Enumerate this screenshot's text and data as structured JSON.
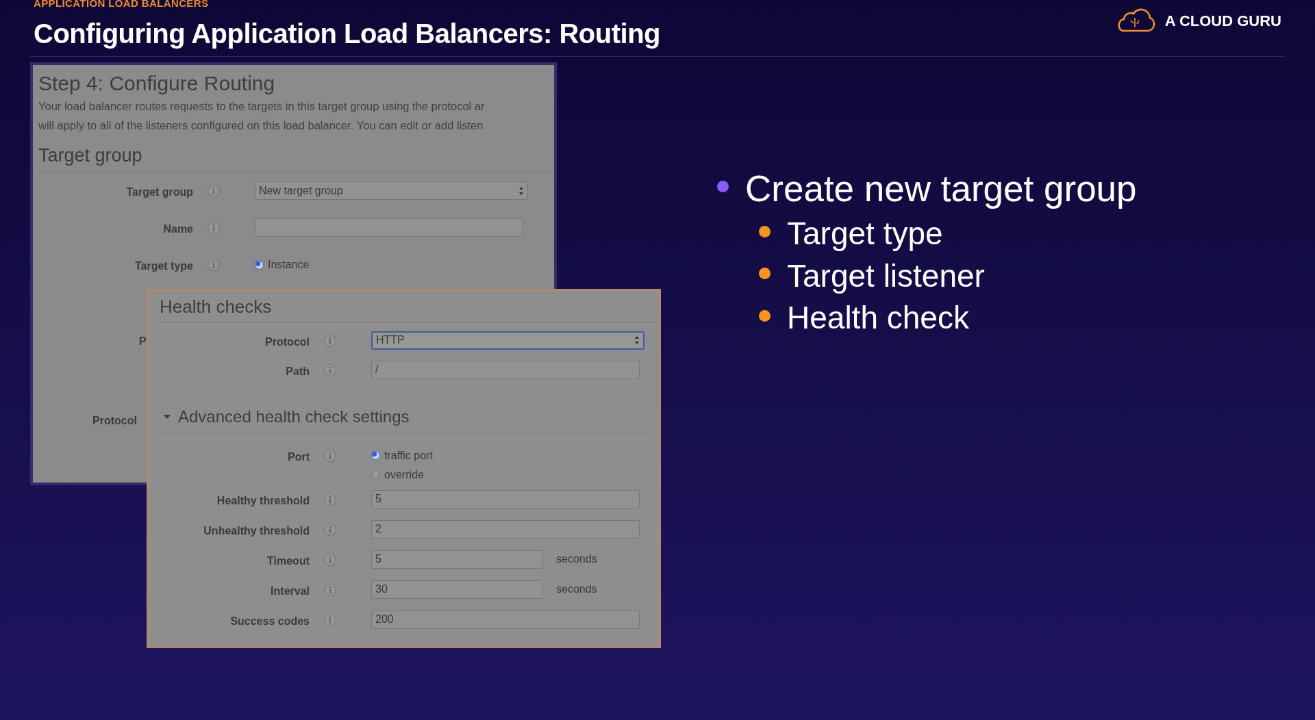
{
  "slide": {
    "section": "APPLICATION LOAD BALANCERS",
    "title": "Configuring Application Load Balancers: Routing"
  },
  "logo": {
    "text": "A CLOUD GURU"
  },
  "routing_step": {
    "title": "Step 4: Configure Routing",
    "description": [
      "Your load balancer routes requests to the targets in this target group using the protocol ar",
      "will apply to all of the listeners configured on this load balancer. You can edit or add listen"
    ],
    "section_title": "Target group",
    "fields": [
      {
        "kind": "select",
        "label": "Target group",
        "value": "New target group",
        "focused": false
      },
      {
        "kind": "text",
        "label": "Name"
      },
      {
        "kind": "radio",
        "label": "Target type",
        "options": [
          {
            "label": "Instance",
            "selected": true
          }
        ]
      }
    ],
    "covered_labels": [
      "P",
      "Protocol"
    ]
  },
  "health_checks": {
    "title": "Health checks",
    "fields": [
      {
        "kind": "select",
        "label": "Protocol",
        "value": "HTTP",
        "focused": true
      },
      {
        "kind": "text",
        "label": "Path",
        "value": "/"
      }
    ],
    "advanced": {
      "title": "Advanced health check settings",
      "expanded": true,
      "fields": [
        {
          "kind": "radio",
          "label": "Port",
          "options": [
            {
              "label": "traffic port",
              "selected": true
            },
            {
              "label": "override",
              "selected": false
            }
          ]
        },
        {
          "kind": "text",
          "label": "Healthy threshold",
          "value": "5"
        },
        {
          "kind": "text",
          "label": "Unhealthy threshold",
          "value": "2"
        },
        {
          "kind": "text",
          "label": "Timeout",
          "value": "5",
          "unit": "seconds"
        },
        {
          "kind": "text",
          "label": "Interval",
          "value": "30",
          "unit": "seconds"
        },
        {
          "kind": "text",
          "label": "Success codes",
          "value": "200"
        }
      ]
    }
  },
  "bullets": [
    {
      "text": "Create new target group",
      "children": [
        {
          "text": "Target type"
        },
        {
          "text": "Target listener"
        },
        {
          "text": "Health check"
        }
      ]
    }
  ]
}
